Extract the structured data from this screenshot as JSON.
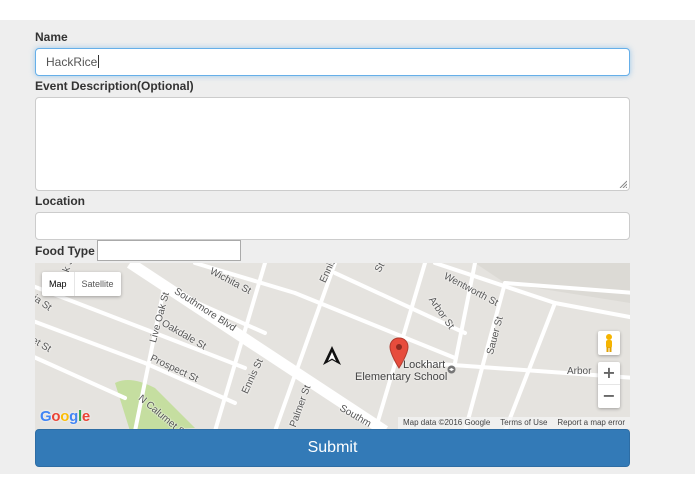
{
  "form": {
    "name_label": "Name",
    "name_value": "HackRice",
    "description_label": "Event Description(Optional)",
    "description_value": "",
    "location_label": "Location",
    "location_value": "",
    "food_type_label": "Food Type",
    "food_type_value": "",
    "submit_label": "Submit"
  },
  "map": {
    "type_buttons": [
      "Map",
      "Satellite"
    ],
    "selected_type": "Map",
    "streets": [
      "Wichita St",
      "Wentworth St",
      "Arbor St",
      "Sauer St",
      "Oakdale St",
      "Southmore Blvd",
      "Prospect St",
      "Ennis St",
      "Palmer St",
      "Live Oak St",
      "N Calumet St",
      "Ennis",
      "Arbor",
      "Southm",
      "ia St",
      "et St",
      "k St",
      "St"
    ],
    "poi": {
      "line1": "Lockhart",
      "line2": "Elementary School"
    },
    "logo_text": "Google",
    "attribution": [
      "Map data ©2016 Google",
      "Terms of Use",
      "Report a map error"
    ],
    "zoom_in": "+",
    "zoom_out": "−",
    "icons": [
      "map-pin-icon",
      "navigation-arrow-icon",
      "pegman-icon",
      "zoom-in-icon",
      "zoom-out-icon"
    ],
    "colors": {
      "land": "#e5e3df",
      "road": "#ffffff",
      "park": "#c5dea0",
      "pin": "#e74c3c"
    }
  },
  "colors": {
    "primary": "#337ab7",
    "focus_border": "#66afe9",
    "panel_bg": "#eeeeee"
  }
}
